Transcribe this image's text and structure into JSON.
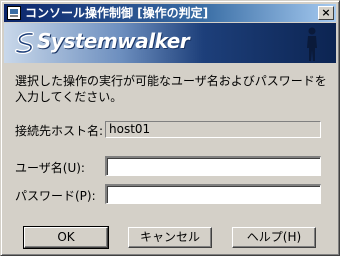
{
  "window": {
    "title": "コンソール操作制御 [操作の判定]",
    "close_glyph": "×"
  },
  "banner": {
    "logo_text": "Systemwalker",
    "brand_color": "#0c2452"
  },
  "dialog": {
    "instruction": "選択した操作の実行が可能なユーザ名およびパスワードを入力してください。",
    "host_label": "接続先ホスト名:",
    "host_value": "host01",
    "user_label": "ユーザ名(U):",
    "user_value": "",
    "password_label": "パスワード(P):",
    "password_value": ""
  },
  "buttons": {
    "ok": "OK",
    "cancel": "キャンセル",
    "help": "ヘルプ(H)"
  },
  "icons": {
    "app": "console-app-icon",
    "close": "close-icon",
    "logo": "systemwalker-logo-icon"
  }
}
